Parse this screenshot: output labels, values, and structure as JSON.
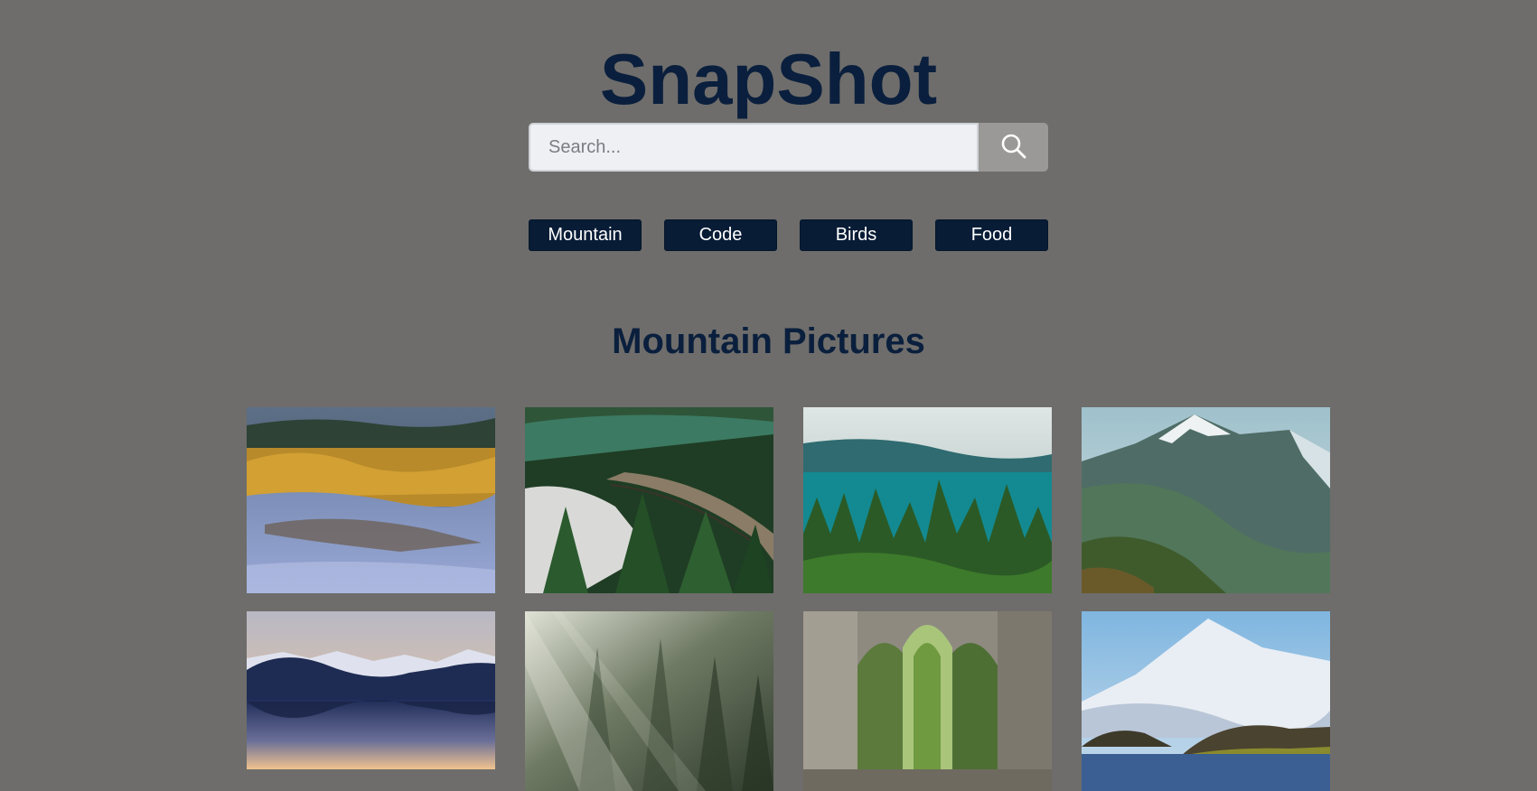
{
  "app": {
    "title": "SnapShot"
  },
  "search": {
    "placeholder": "Search...",
    "value": ""
  },
  "categories": [
    "Mountain",
    "Code",
    "Birds",
    "Food"
  ],
  "section": {
    "title": "Mountain Pictures"
  },
  "colors": {
    "background": "#6e6d6b",
    "brand": "#0a1f3d",
    "nav_button": "#081c36",
    "search_button": "#9a9998"
  },
  "icons": {
    "search": "search-icon"
  },
  "photos": [
    "autumn-lake-marsh-photo",
    "railway-forest-photo",
    "turquoise-lake-pines-photo",
    "green-mountain-snowcap-photo",
    "mountain-lake-reflection-photo",
    "misty-forest-sunrays-photo",
    "gothic-ruin-window-photo",
    "snowy-volcano-lake-photo"
  ]
}
